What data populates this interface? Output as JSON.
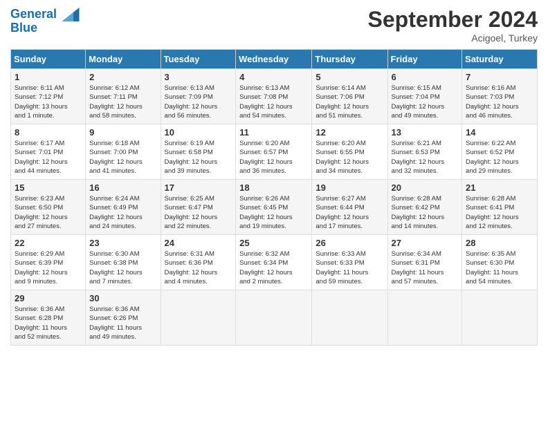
{
  "header": {
    "logo_line1": "General",
    "logo_line2": "Blue",
    "month_title": "September 2024",
    "location": "Acigoel, Turkey"
  },
  "days_of_week": [
    "Sunday",
    "Monday",
    "Tuesday",
    "Wednesday",
    "Thursday",
    "Friday",
    "Saturday"
  ],
  "weeks": [
    [
      {
        "day": "1",
        "info": "Sunrise: 6:11 AM\nSunset: 7:12 PM\nDaylight: 13 hours\nand 1 minute."
      },
      {
        "day": "2",
        "info": "Sunrise: 6:12 AM\nSunset: 7:11 PM\nDaylight: 12 hours\nand 58 minutes."
      },
      {
        "day": "3",
        "info": "Sunrise: 6:13 AM\nSunset: 7:09 PM\nDaylight: 12 hours\nand 56 minutes."
      },
      {
        "day": "4",
        "info": "Sunrise: 6:13 AM\nSunset: 7:08 PM\nDaylight: 12 hours\nand 54 minutes."
      },
      {
        "day": "5",
        "info": "Sunrise: 6:14 AM\nSunset: 7:06 PM\nDaylight: 12 hours\nand 51 minutes."
      },
      {
        "day": "6",
        "info": "Sunrise: 6:15 AM\nSunset: 7:04 PM\nDaylight: 12 hours\nand 49 minutes."
      },
      {
        "day": "7",
        "info": "Sunrise: 6:16 AM\nSunset: 7:03 PM\nDaylight: 12 hours\nand 46 minutes."
      }
    ],
    [
      {
        "day": "8",
        "info": "Sunrise: 6:17 AM\nSunset: 7:01 PM\nDaylight: 12 hours\nand 44 minutes."
      },
      {
        "day": "9",
        "info": "Sunrise: 6:18 AM\nSunset: 7:00 PM\nDaylight: 12 hours\nand 41 minutes."
      },
      {
        "day": "10",
        "info": "Sunrise: 6:19 AM\nSunset: 6:58 PM\nDaylight: 12 hours\nand 39 minutes."
      },
      {
        "day": "11",
        "info": "Sunrise: 6:20 AM\nSunset: 6:57 PM\nDaylight: 12 hours\nand 36 minutes."
      },
      {
        "day": "12",
        "info": "Sunrise: 6:20 AM\nSunset: 6:55 PM\nDaylight: 12 hours\nand 34 minutes."
      },
      {
        "day": "13",
        "info": "Sunrise: 6:21 AM\nSunset: 6:53 PM\nDaylight: 12 hours\nand 32 minutes."
      },
      {
        "day": "14",
        "info": "Sunrise: 6:22 AM\nSunset: 6:52 PM\nDaylight: 12 hours\nand 29 minutes."
      }
    ],
    [
      {
        "day": "15",
        "info": "Sunrise: 6:23 AM\nSunset: 6:50 PM\nDaylight: 12 hours\nand 27 minutes."
      },
      {
        "day": "16",
        "info": "Sunrise: 6:24 AM\nSunset: 6:49 PM\nDaylight: 12 hours\nand 24 minutes."
      },
      {
        "day": "17",
        "info": "Sunrise: 6:25 AM\nSunset: 6:47 PM\nDaylight: 12 hours\nand 22 minutes."
      },
      {
        "day": "18",
        "info": "Sunrise: 6:26 AM\nSunset: 6:45 PM\nDaylight: 12 hours\nand 19 minutes."
      },
      {
        "day": "19",
        "info": "Sunrise: 6:27 AM\nSunset: 6:44 PM\nDaylight: 12 hours\nand 17 minutes."
      },
      {
        "day": "20",
        "info": "Sunrise: 6:28 AM\nSunset: 6:42 PM\nDaylight: 12 hours\nand 14 minutes."
      },
      {
        "day": "21",
        "info": "Sunrise: 6:28 AM\nSunset: 6:41 PM\nDaylight: 12 hours\nand 12 minutes."
      }
    ],
    [
      {
        "day": "22",
        "info": "Sunrise: 6:29 AM\nSunset: 6:39 PM\nDaylight: 12 hours\nand 9 minutes."
      },
      {
        "day": "23",
        "info": "Sunrise: 6:30 AM\nSunset: 6:38 PM\nDaylight: 12 hours\nand 7 minutes."
      },
      {
        "day": "24",
        "info": "Sunrise: 6:31 AM\nSunset: 6:36 PM\nDaylight: 12 hours\nand 4 minutes."
      },
      {
        "day": "25",
        "info": "Sunrise: 6:32 AM\nSunset: 6:34 PM\nDaylight: 12 hours\nand 2 minutes."
      },
      {
        "day": "26",
        "info": "Sunrise: 6:33 AM\nSunset: 6:33 PM\nDaylight: 11 hours\nand 59 minutes."
      },
      {
        "day": "27",
        "info": "Sunrise: 6:34 AM\nSunset: 6:31 PM\nDaylight: 11 hours\nand 57 minutes."
      },
      {
        "day": "28",
        "info": "Sunrise: 6:35 AM\nSunset: 6:30 PM\nDaylight: 11 hours\nand 54 minutes."
      }
    ],
    [
      {
        "day": "29",
        "info": "Sunrise: 6:36 AM\nSunset: 6:28 PM\nDaylight: 11 hours\nand 52 minutes."
      },
      {
        "day": "30",
        "info": "Sunrise: 6:36 AM\nSunset: 6:26 PM\nDaylight: 11 hours\nand 49 minutes."
      },
      null,
      null,
      null,
      null,
      null
    ]
  ]
}
